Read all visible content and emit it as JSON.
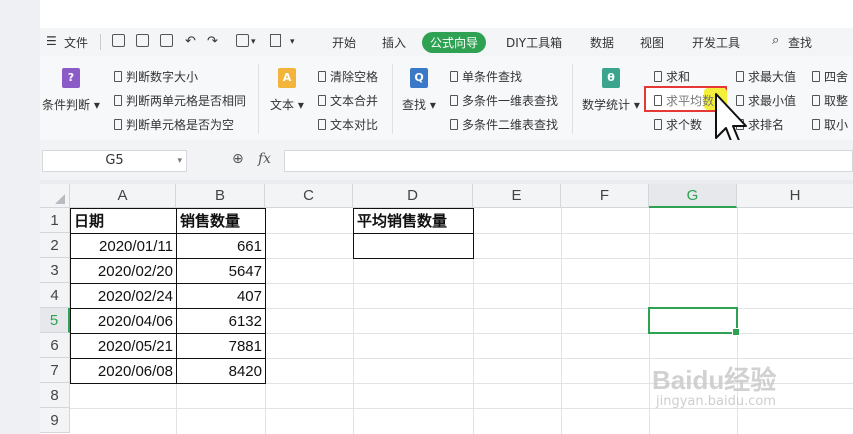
{
  "menu": {
    "file_label": "文件",
    "tabs": [
      "开始",
      "插入",
      "公式向导",
      "DIY工具箱",
      "数据",
      "视图",
      "开发工具"
    ],
    "active_tab": "公式向导",
    "search_label": "查找"
  },
  "ribbon": {
    "group_condition": {
      "label": "条件判断",
      "items": [
        "判断数字大小",
        "判断两单元格是否相同",
        "判断单元格是否为空"
      ]
    },
    "group_text": {
      "label": "文本",
      "items": [
        "清除空格",
        "文本合并",
        "文本对比"
      ]
    },
    "group_lookup": {
      "label": "查找",
      "items": [
        "单条件查找",
        "多条件一维表查找",
        "多条件二维表查找"
      ]
    },
    "group_math": {
      "label": "数学统计",
      "col1": [
        "求和",
        "求平均数",
        "求个数"
      ],
      "col2": [
        "求最大值",
        "求最小值",
        "求排名"
      ],
      "col3": [
        "四舍",
        "取整",
        "取小"
      ]
    },
    "highlighted_item": "求平均数",
    "colors": {
      "accent_green": "#2ea152",
      "highlight_red": "#e53935",
      "highlight_yellow": "#f4ef3a"
    }
  },
  "formula_bar": {
    "cell_ref": "G5",
    "fx_label": "fx",
    "formula_value": ""
  },
  "sheet": {
    "columns": [
      "A",
      "B",
      "C",
      "D",
      "E",
      "F",
      "G",
      "H"
    ],
    "rows": [
      "1",
      "2",
      "3",
      "4",
      "5",
      "6",
      "7",
      "8",
      "9"
    ],
    "selected_cell": "G5",
    "a_header": "日期",
    "b_header": "销售数量",
    "d_header": "平均销售数量",
    "data": [
      {
        "date": "2020/01/11",
        "qty": "661"
      },
      {
        "date": "2020/02/20",
        "qty": "5647"
      },
      {
        "date": "2020/02/24",
        "qty": "407"
      },
      {
        "date": "2020/04/06",
        "qty": "6132"
      },
      {
        "date": "2020/05/21",
        "qty": "7881"
      },
      {
        "date": "2020/06/08",
        "qty": "8420"
      }
    ]
  },
  "watermark": {
    "text": "Baidu经验",
    "url_text": "jingyan.baidu.com"
  }
}
